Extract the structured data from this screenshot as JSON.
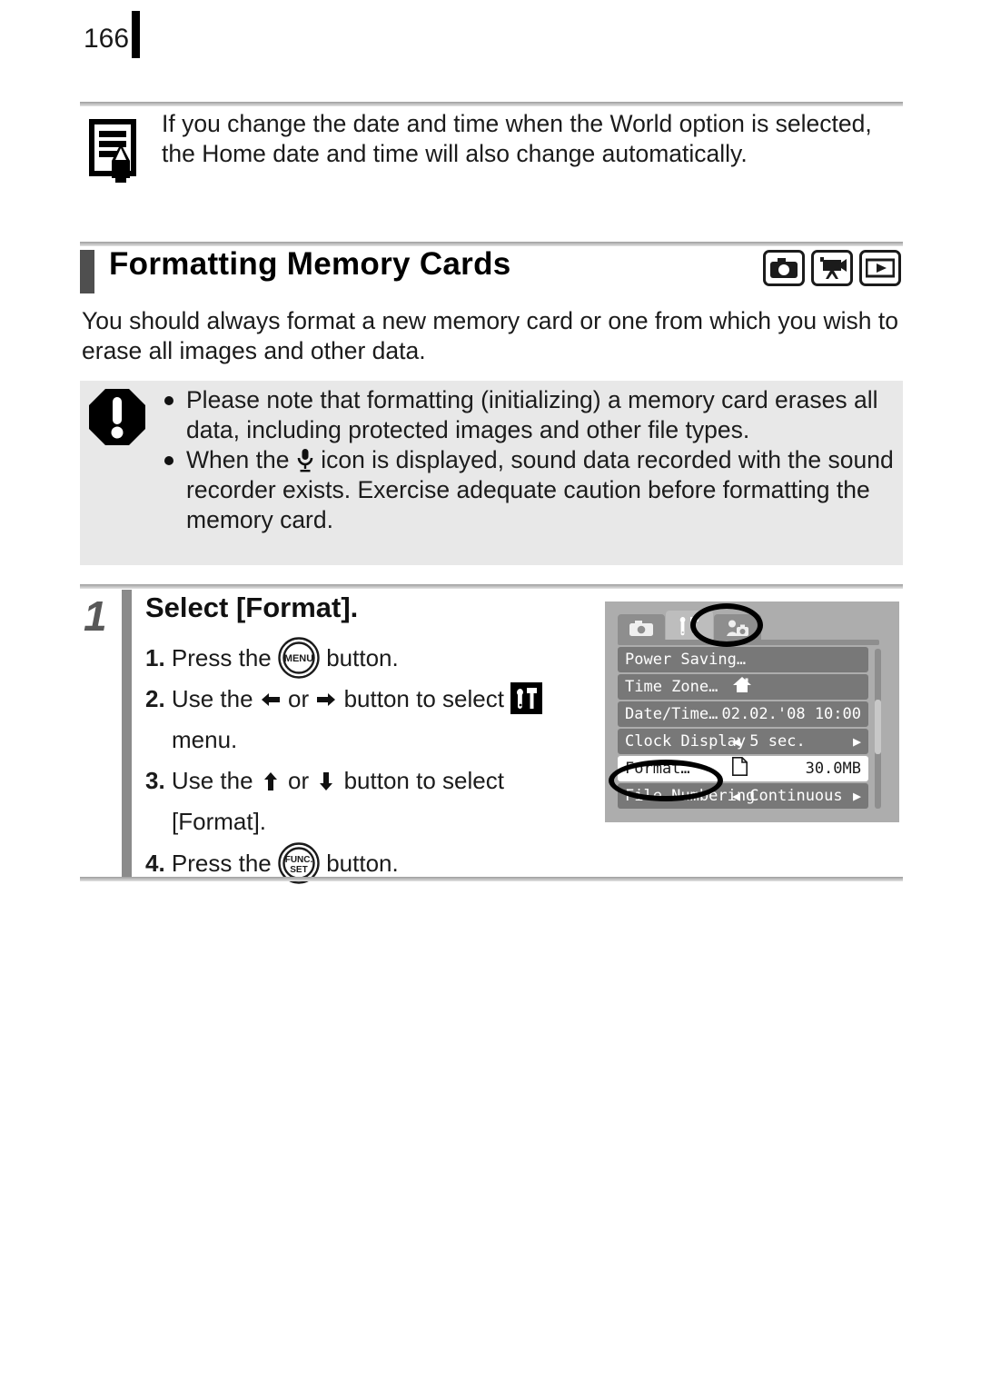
{
  "page": {
    "number": "166"
  },
  "note": {
    "icon": "note-pencil-icon",
    "text": "If you change the date and time when the World option is selected, the Home date and time will also change automatically."
  },
  "section": {
    "title": "Formatting Memory Cards",
    "mode_icons": [
      {
        "name": "still-camera-icon",
        "label": "Still image mode"
      },
      {
        "name": "movie-camera-icon",
        "label": "Movie mode"
      },
      {
        "name": "playback-icon",
        "label": "Playback mode"
      }
    ]
  },
  "intro": {
    "text": "You should always format a new memory card or one from which you wish to erase all images and other data."
  },
  "caution": {
    "icon": "exclamation-octagon-icon",
    "items": [
      {
        "text_before": "Please note that formatting (initializing) a memory card erases all data, including protected images and other file types.",
        "icon": "",
        "text_after": ""
      },
      {
        "text_before": "When the",
        "icon": "microphone-icon",
        "text_after": "icon is displayed, sound data recorded with the sound recorder exists. Exercise adequate caution before formatting the memory card."
      }
    ]
  },
  "step": {
    "number": "1",
    "title": "Select [Format].",
    "substeps": [
      {
        "marker": "1.",
        "text_before": "Press the",
        "icon": "menu-button-icon",
        "icon_label": "MENU",
        "text_after": "button."
      },
      {
        "marker": "2.",
        "text_before": "Use the",
        "icon_left": "left-arrow-icon",
        "conjunction": "or",
        "icon_right": "right-arrow-icon",
        "text_middle": "button to select",
        "icon": "setup-tools-icon",
        "text_after": "menu."
      },
      {
        "marker": "3.",
        "text_before": "Use the",
        "icon_left": "up-arrow-icon",
        "conjunction": "or",
        "icon_right": "down-arrow-icon",
        "text_middle": "button to select",
        "text_after": "[Format]."
      },
      {
        "marker": "4.",
        "text_before": "Press the",
        "icon": "func-set-button-icon",
        "icon_label_1": "FUNC.",
        "icon_label_2": "SET",
        "text_after": "button."
      }
    ]
  },
  "lcd": {
    "tabs": [
      {
        "name": "tab-shooting",
        "icon": "camera-icon",
        "active": false
      },
      {
        "name": "tab-setup",
        "icon": "tools-icon",
        "active": true
      },
      {
        "name": "tab-my-camera",
        "icon": "my-camera-icon",
        "active": false
      }
    ],
    "rows": [
      {
        "label": "Power Saving…",
        "value": "",
        "value_icon": "",
        "selected": false,
        "arrows": false
      },
      {
        "label": "Time Zone…",
        "value": "",
        "value_icon": "home-icon",
        "selected": false,
        "arrows": false
      },
      {
        "label": "Date/Time…",
        "value": "02.02.'08 10:00",
        "value_icon": "",
        "selected": false,
        "arrows": false
      },
      {
        "label": "Clock Display",
        "value": "5 sec.",
        "value_icon": "",
        "selected": false,
        "arrows": true
      },
      {
        "label": "Format…",
        "value": "30.0MB",
        "value_icon": "memory-card-icon",
        "selected": true,
        "arrows": false
      },
      {
        "label": "File Numbering",
        "value": "Continuous",
        "value_icon": "",
        "selected": false,
        "arrows": true
      }
    ],
    "annotations": [
      {
        "name": "setup-tab-highlight-ellipse"
      },
      {
        "name": "format-row-highlight-ellipse"
      }
    ]
  },
  "colors": {
    "page_background": "#ffffff",
    "caution_background": "#e8e8e8",
    "step_bar": "#8b8b8b",
    "section_bar": "#4f4f4f",
    "lcd_background": "#adadad",
    "lcd_row": "#787878",
    "lcd_row_selected": "#ffffff"
  }
}
